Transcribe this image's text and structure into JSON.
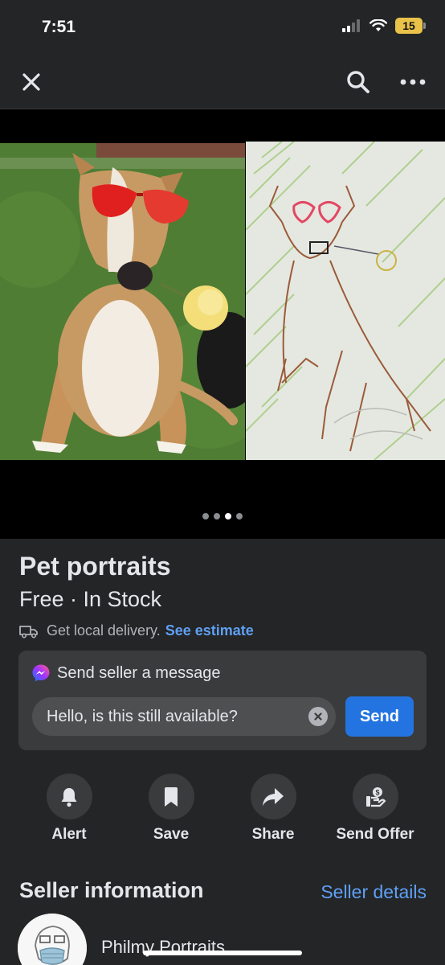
{
  "status": {
    "time": "7:51",
    "battery": "15"
  },
  "icons": {
    "close": "close-icon",
    "search": "search-icon",
    "more": "more-icon"
  },
  "gallery": {
    "page_count": 4,
    "active_index": 2
  },
  "listing": {
    "title": "Pet portraits",
    "price_stock": "Free · In Stock",
    "delivery_text": "Get local delivery.",
    "delivery_link": "See estimate"
  },
  "message": {
    "header": "Send seller a message",
    "input_value": "Hello, is this still available?",
    "send_label": "Send"
  },
  "actions": [
    {
      "label": "Alert",
      "icon": "bell-icon"
    },
    {
      "label": "Save",
      "icon": "bookmark-icon"
    },
    {
      "label": "Share",
      "icon": "share-icon"
    },
    {
      "label": "Send Offer",
      "icon": "offer-icon"
    }
  ],
  "seller": {
    "heading": "Seller information",
    "details_link": "Seller details",
    "name": "Philmy Portraits"
  },
  "colors": {
    "accent": "#2374e1",
    "link": "#5fa0f5",
    "background": "#242526"
  }
}
